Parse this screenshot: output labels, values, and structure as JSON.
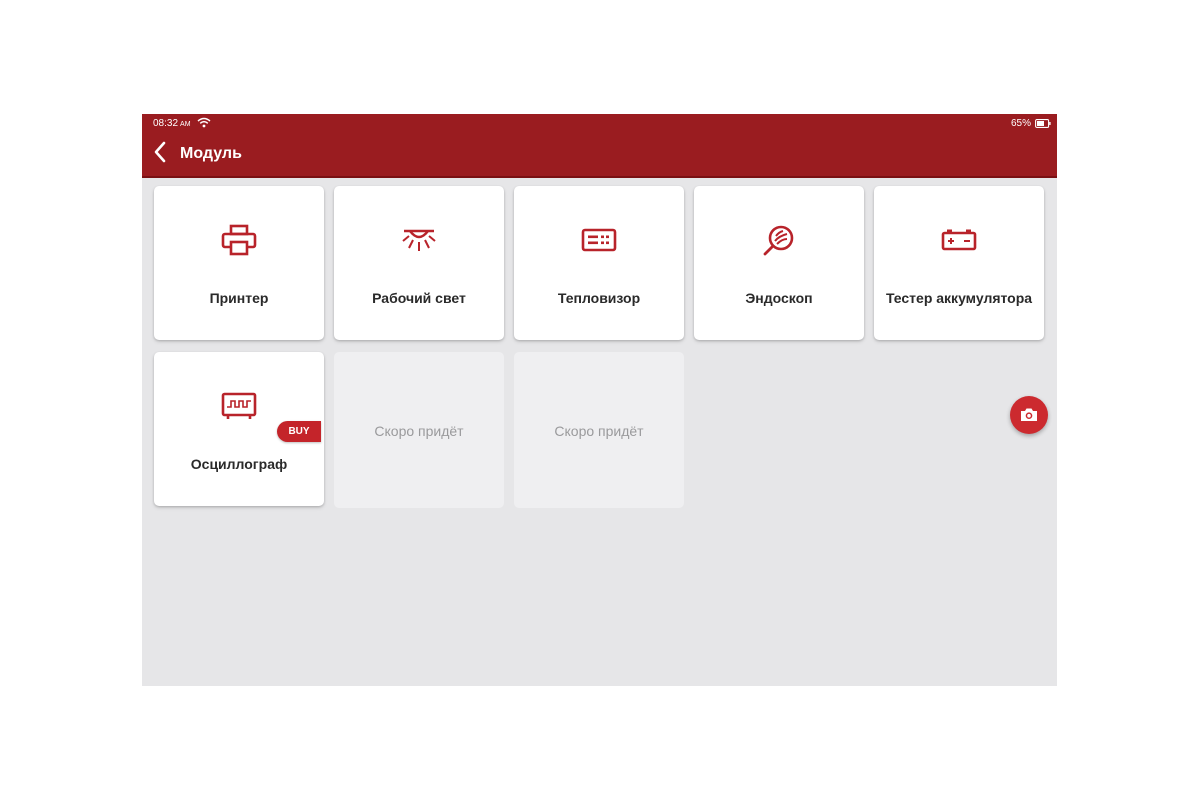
{
  "status_bar": {
    "time": "08:32",
    "ampm": "AM",
    "battery": "65%"
  },
  "header": {
    "title": "Модуль"
  },
  "tiles": [
    {
      "label": "Принтер",
      "icon": "printer-icon"
    },
    {
      "label": "Рабочий свет",
      "icon": "work-light-icon"
    },
    {
      "label": "Тепловизор",
      "icon": "thermal-imager-icon"
    },
    {
      "label": "Эндоскоп",
      "icon": "endoscope-icon"
    },
    {
      "label": "Тестер аккумулятора",
      "icon": "battery-tester-icon"
    },
    {
      "label": "Осциллограф",
      "icon": "oscilloscope-icon",
      "badge": "BUY"
    },
    {
      "label": "Скоро придёт"
    },
    {
      "label": "Скоро придёт"
    }
  ],
  "colors": {
    "header": "#9a1c20",
    "accent": "#b8232a",
    "background": "#e6e6e8"
  }
}
